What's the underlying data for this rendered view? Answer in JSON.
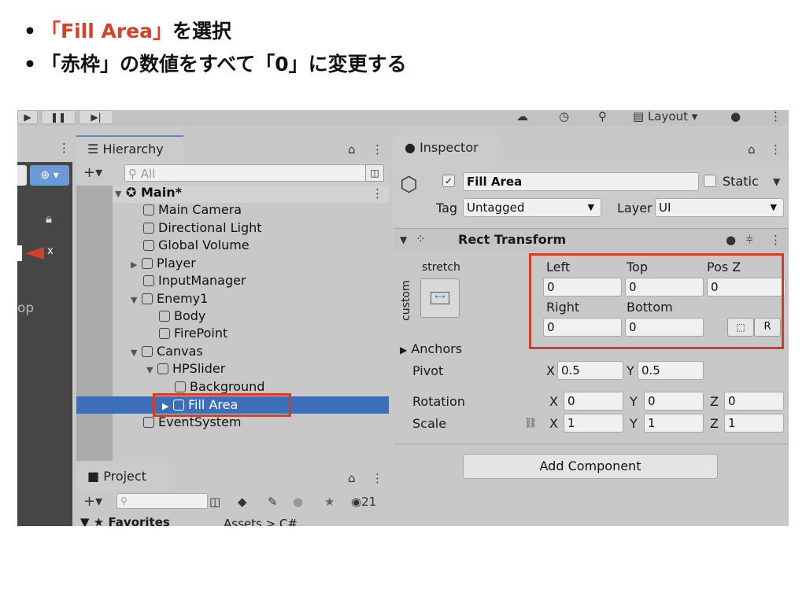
{
  "instructions": {
    "line1_highlight": "「Fill Area」",
    "line1_rest": "を選択",
    "line2": "「赤枠」の数値をすべて「0」に変更する"
  },
  "toolbar": {
    "layout_label": "Layout"
  },
  "hierarchy": {
    "tab_label": "Hierarchy",
    "search_placeholder": "All",
    "scene_name": "Main*",
    "items": [
      {
        "label": "Main Camera"
      },
      {
        "label": "Directional Light"
      },
      {
        "label": "Global Volume"
      },
      {
        "label": "Player"
      },
      {
        "label": "InputManager"
      },
      {
        "label": "Enemy1"
      },
      {
        "label": "Body"
      },
      {
        "label": "FirePoint"
      },
      {
        "label": "Canvas"
      },
      {
        "label": "HPSlider"
      },
      {
        "label": "Background"
      },
      {
        "label": "Fill Area"
      },
      {
        "label": "EventSystem"
      }
    ]
  },
  "scene": {
    "side_label": "op"
  },
  "project": {
    "tab_label": "Project",
    "hidden_count": "21",
    "favorites_label": "Favorites",
    "breadcrumb": "Assets > C#"
  },
  "inspector": {
    "tab_label": "Inspector",
    "object_name": "Fill Area",
    "static_label": "Static",
    "tag_label": "Tag",
    "tag_value": "Untagged",
    "layer_label": "Layer",
    "layer_value": "UI",
    "component_title": "Rect Transform",
    "anchor_preset_top": "stretch",
    "anchor_preset_side": "custom",
    "left_label": "Left",
    "left_value": "0",
    "top_label": "Top",
    "top_value": "0",
    "posz_label": "Pos Z",
    "posz_value": "0",
    "right_label": "Right",
    "right_value": "0",
    "bottom_label": "Bottom",
    "bottom_value": "0",
    "r_button": "R",
    "anchors_label": "Anchors",
    "pivot_label": "Pivot",
    "pivot_x": "0.5",
    "pivot_y": "0.5",
    "rotation_label": "Rotation",
    "rot_x": "0",
    "rot_y": "0",
    "rot_z": "0",
    "scale_label": "Scale",
    "scale_x": "1",
    "scale_y": "1",
    "scale_z": "1",
    "x_label": "X",
    "y_label": "Y",
    "z_label": "Z",
    "add_component": "Add Component"
  },
  "colors": {
    "highlight_red": "#d83b22",
    "selection_blue": "#3d6fb8",
    "tab_accent": "#5a88c6"
  }
}
